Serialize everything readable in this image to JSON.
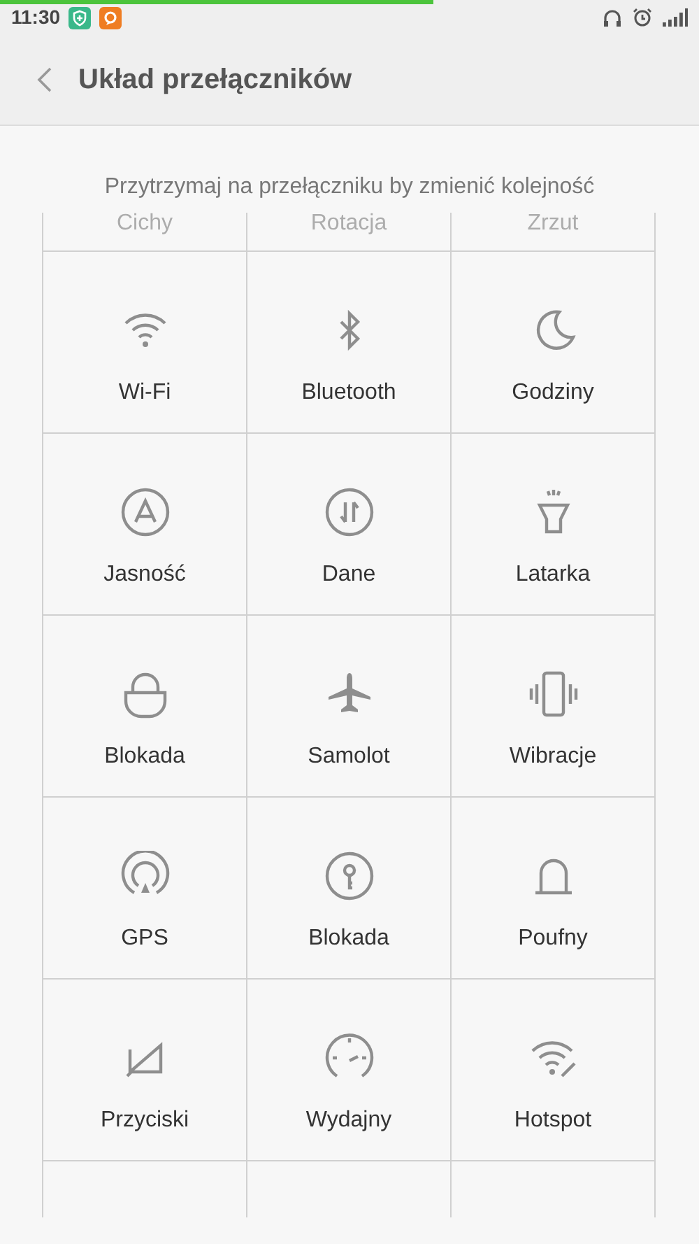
{
  "status_bar": {
    "time": "11:30",
    "progress": {
      "level": 0.62
    }
  },
  "header": {
    "title": "Układ przełączników"
  },
  "hint": "Przytrzymaj na przełączniku by zmienić kolejność",
  "partial_row": [
    "Cichy",
    "Rotacja",
    "Zrzut"
  ],
  "toggles": [
    {
      "label": "Wi-Fi"
    },
    {
      "label": "Bluetooth"
    },
    {
      "label": "Godziny"
    },
    {
      "label": "Jasność"
    },
    {
      "label": "Dane"
    },
    {
      "label": "Latarka"
    },
    {
      "label": "Blokada"
    },
    {
      "label": "Samolot"
    },
    {
      "label": "Wibracje"
    },
    {
      "label": "GPS"
    },
    {
      "label": "Blokada"
    },
    {
      "label": "Poufny"
    },
    {
      "label": "Przyciski"
    },
    {
      "label": "Wydajny"
    },
    {
      "label": "Hotspot"
    }
  ]
}
